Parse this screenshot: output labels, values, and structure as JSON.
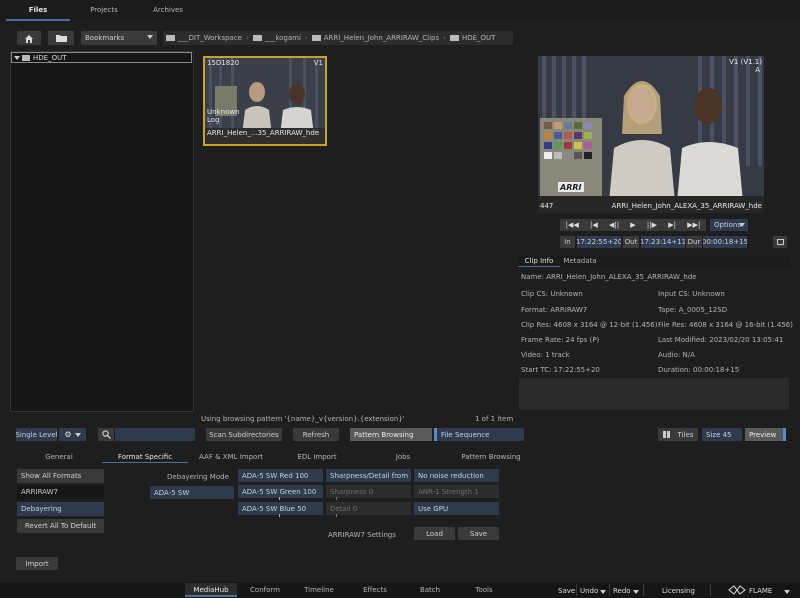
{
  "top_tabs": [
    "Files",
    "Projects",
    "Archives"
  ],
  "bookmarks_label": "Bookmarks",
  "path": [
    "___DIT_Workspace",
    "___kogami",
    "ARRI_Helen_John_ARRIRAW_Clips",
    "HDE_OUT"
  ],
  "tree_root": "HDE_OUT",
  "thumb": {
    "tc": "15D1820",
    "ver": "V1",
    "cs": "Unknown",
    "cs2": "Log",
    "name": "ARRI_Helen_...35_ARRIRAW_hde"
  },
  "viewer": {
    "ver": "V1 (V1.1)",
    "sub": "A",
    "frame": "447",
    "name": "ARRI_Helen_John_ALEXA_35_ARRIRAW_hde",
    "logo": "ARRI"
  },
  "transport": {
    "options": "Options",
    "in_label": "In",
    "in_tc": "17:22:55+20",
    "out_label": "Out",
    "out_tc": "17:23:14+11",
    "dur_label": "Dur",
    "dur_tc": "00:00:18+15"
  },
  "info_tabs": [
    "Clip Info",
    "Metadata"
  ],
  "clip_info": {
    "name": "Name: ARRI_Helen_John_ALEXA_35_ARRIRAW_hde",
    "clip_cs": "Clip CS: Unknown",
    "input_cs": "Input CS: Unknown",
    "format": "Format: ARRIRAW7",
    "tape": "Tape: A_0005_12SD",
    "clip_res": "Clip Res: 4608 x 3164 @ 12-bit (1.456)",
    "file_res": "File Res: 4608 x 3164 @ 16-bit (1.456)",
    "frame_rate": "Frame Rate: 24 fps (P)",
    "last_mod": "Last Modified: 2023/02/20 13:05:41",
    "video": "Video: 1 track",
    "audio": "Audio: N/A",
    "start_tc": "Start TC: 17:22:55+20",
    "duration": "Duration: 00:00:18+15"
  },
  "pattern_text": "Using browsing pattern '{name}_v{version}.{extension}'",
  "count_text": "1 of 1 item",
  "toolbar": {
    "single_level": "Single Level",
    "scan": "Scan Subdirectories",
    "refresh": "Refresh",
    "pattern": "Pattern Browsing",
    "file_seq": "File Sequence",
    "tiles": "Tiles",
    "size": "Size 45",
    "preview": "Preview"
  },
  "bottom_tabs": [
    "General",
    "Format Specific",
    "AAF & XML Import",
    "EDL Import",
    "Jobs",
    "Pattern Browsing"
  ],
  "left_list": {
    "show_all": "Show All Formats",
    "format": "ARRIRAW7",
    "debayering": "Debayering",
    "revert": "Revert All To Default"
  },
  "format_panel": {
    "debayer_label": "Debayering Mode",
    "ada5": "ADA-5 SW",
    "red": "ADA-5 SW Red 100",
    "green": "ADA-5 SW Green 100",
    "blue": "ADA-5 SW Blue 50",
    "sharp_from_file": "Sharpness/Detail from File",
    "sharpness": "Sharpness 0",
    "detail": "Detail 0",
    "noise": "No noise reduction",
    "anr": "ANR-1 Strength 1",
    "gpu": "Use GPU",
    "settings_label": "ARRIRAW7 Settings",
    "load": "Load",
    "save": "Save"
  },
  "import_label": "Import",
  "bottom_bar": {
    "tabs": [
      "MediaHub",
      "Conform",
      "Timeline",
      "Effects",
      "Batch",
      "Tools"
    ],
    "save": "Save",
    "undo": "Undo",
    "redo": "Redo",
    "licensing": "Licensing",
    "flame": "FLAME"
  }
}
